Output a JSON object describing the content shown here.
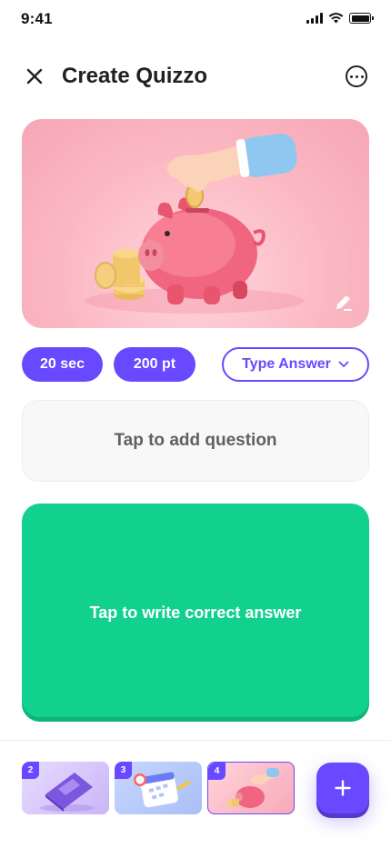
{
  "status_bar": {
    "time": "9:41"
  },
  "header": {
    "title": "Create Quizzo",
    "close_icon": "close-icon",
    "more_icon": "more-options-icon"
  },
  "cover": {
    "description_icon": "piggy-bank-image",
    "edit_icon": "pencil-icon"
  },
  "chips": {
    "time_label": "20 sec",
    "points_label": "200 pt",
    "type_label": "Type Answer"
  },
  "question": {
    "placeholder": "Tap to add question"
  },
  "answer": {
    "placeholder": "Tap to write correct answer"
  },
  "slides": [
    {
      "number": "2"
    },
    {
      "number": "3"
    },
    {
      "number": "4"
    }
  ],
  "colors": {
    "accent": "#6949ff",
    "answer_green": "#12d18e",
    "text": "#212121"
  }
}
